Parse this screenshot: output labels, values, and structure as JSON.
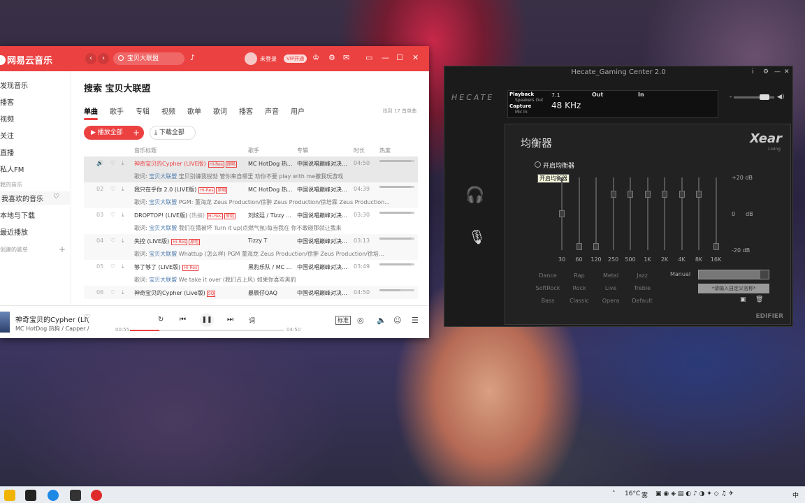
{
  "netease": {
    "app_title": "网易云音乐",
    "search_text": "宝贝大联盟",
    "login": "未登录",
    "vip": "VIP开通",
    "sidebar": [
      "发现音乐",
      "播客",
      "视频",
      "关注",
      "直播",
      "私人FM"
    ],
    "sidebar_section": "我的音乐",
    "my_music": [
      "我喜欢的音乐",
      "本地与下载",
      "最近播放"
    ],
    "playlist_section": "创建的歌单",
    "page_title": "搜索 宝贝大联盟",
    "tabs": [
      "单曲",
      "歌手",
      "专辑",
      "视频",
      "歌单",
      "歌词",
      "播客",
      "声音",
      "用户"
    ],
    "found": "找到 17 首单曲",
    "play_all": "播放全部",
    "download_all": "下载全部",
    "headers": [
      "音乐标题",
      "歌手",
      "专辑",
      "时长",
      "热度"
    ],
    "rows": [
      {
        "num": "",
        "title": "神奇宝贝的Cypher (LIVE版)",
        "artist": "MC HotDog 热...",
        "album": "中国说唱巅峰对决...",
        "time": "04:50",
        "hot": 0.9,
        "lyric_label": "歌词:",
        "lyric_hl": "宝贝大联盟",
        "lyric": "宝贝别嫌我锐勃 管你来自哪里 劝你不要 play with me撤我玩游戏",
        "hires": "Hi-Res",
        "mv": "原唱"
      },
      {
        "num": "02",
        "title": "我只在乎你 2.0 (LIVE版)",
        "artist": "MC HotDog 热...",
        "album": "中国说唱巅峰对决...",
        "time": "04:39",
        "hot": 0.9,
        "lyric_label": "歌词:",
        "lyric_hl": "宝贝大联盟",
        "lyric": "PGM: 董海龙 Zeus Production/徐翀 Zeus Production/徐培霖 Zeus Production...",
        "hires": "Hi-Res",
        "mv": "原唱"
      },
      {
        "num": "03",
        "title": "DROPTOP! (LIVE版)",
        "extra": "(热搞)",
        "artist": "刘炫廷 / Tizzy ...",
        "album": "中国说唱巅峰对决...",
        "time": "03:30",
        "hot": 0.9,
        "lyric_label": "歌词:",
        "lyric_hl": "宝贝大联盟",
        "lyric": "我们在猜被坏 Turn it up(点燃气氛)每当我在 你不敢碰那就让我来",
        "hires": "Hi-Res",
        "mv": "原唱"
      },
      {
        "num": "04",
        "title": "失控 (LIVE版)",
        "artist": "Tizzy T",
        "album": "中国说唱巅峰对决...",
        "time": "03:13",
        "hot": 0.9,
        "lyric_label": "歌词:",
        "lyric_hl": "宝贝大联盟",
        "lyric": "Whattup (怎么样) PGM 董海龙 Zeus Production/徐翀 Zeus Production/徐培...",
        "hires": "Hi-Res",
        "mv": "原唱"
      },
      {
        "num": "05",
        "title": "够了够了 (LIVE版)",
        "artist": "黑豹乐队 / MC ...",
        "album": "中国说唱巅峰对决...",
        "time": "03:49",
        "hot": 0.9,
        "lyric_label": "歌词:",
        "lyric_hl": "宝贝大联盟",
        "lyric": "We take it over (我们占上风) 如果你喜欢黑豹",
        "hires": "Hi-Res",
        "mv": ""
      },
      {
        "num": "06",
        "title": "神奇宝贝的Cypher (Live版)",
        "artist": "暴辰仔QAQ",
        "album": "中国说唱巅峰对决...",
        "time": "04:50",
        "hot": 0.6,
        "lyric_label": "",
        "lyric_hl": "",
        "lyric": "",
        "hires": "",
        "mv": "SQ"
      }
    ],
    "now_title": "神奇宝贝的Cypher (LI\\",
    "now_artist": "MC HotDog 热狗 / Capper /",
    "time_cur": "00:55",
    "time_total": "04:50",
    "progress": 0.19,
    "lyric_btn": "词",
    "quality": "标准"
  },
  "hecate": {
    "title": "Hecate_Gaming Center 2.0",
    "logo": "HECATE",
    "playback": "Playback",
    "speakers": "Speakers Out",
    "capture": "Capture",
    "mic_in": "Mic In",
    "channels": "7.1",
    "rate": "48 KHz",
    "out": "Out",
    "in": "In",
    "eq_title": "均衡器",
    "brand": "Xear",
    "brand_sub": "Living",
    "enable": "开启均衡器",
    "tooltip": "开启均衡器",
    "db_labels": [
      "+20 dB",
      "0",
      "dB",
      "-20 dB"
    ],
    "bands": [
      "30",
      "60",
      "120",
      "250",
      "500",
      "1K",
      "2K",
      "4K",
      "8K",
      "16K"
    ],
    "band_values_db": [
      0,
      -20,
      -20,
      12,
      12,
      12,
      12,
      12,
      12,
      -20
    ],
    "presets": [
      "Dance",
      "Rap",
      "Metal",
      "Jazz",
      "SoftRock",
      "Rock",
      "Live",
      "Treble",
      "Bass",
      "Classic",
      "Opera",
      "Default"
    ],
    "manual": "Manual",
    "custom": "*请输入自定义名称*",
    "edifier": "EDIFIER",
    "volume": 0.85
  },
  "taskbar": {
    "temp": "16°C",
    "weather": "雾",
    "ime": "中"
  }
}
